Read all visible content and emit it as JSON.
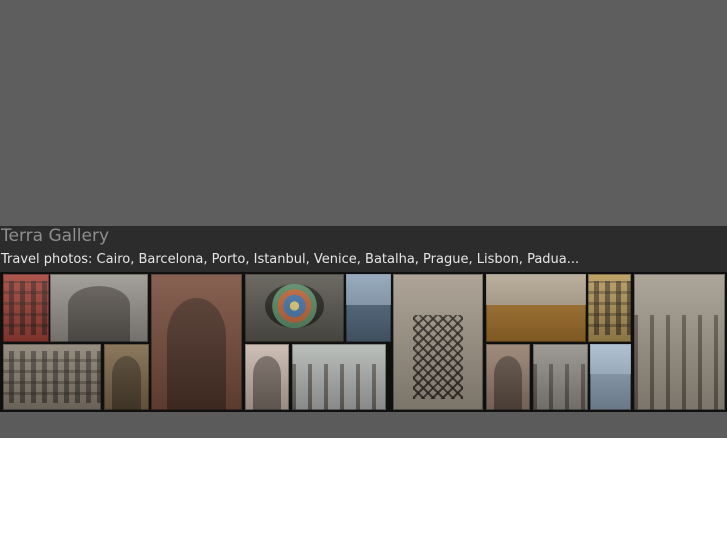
{
  "site": {
    "title": "Terra Gallery",
    "subtitle": "Travel photos: Cairo, Barcelona, Porto, Istanbul, Venice, Batalha, Prague, Lisbon, Padua..."
  },
  "colors": {
    "top_band": "#5e5e5e",
    "header_band": "#2c2c2c",
    "title_text": "#8e8e8e",
    "subtitle_text": "#e6e6e6",
    "strip_background": "#101010",
    "bottom_band": "#5b5b5b"
  },
  "gallery": {
    "thumbnails": [
      {
        "name": "photo-red-facade",
        "color": "#a5433a",
        "motif": "win"
      },
      {
        "name": "photo-ornate-pavilion",
        "color": "#9a9690",
        "motif": "arch"
      },
      {
        "name": "photo-venice-canal-bridge",
        "color": "#7a4f3e",
        "motif": "arch"
      },
      {
        "name": "photo-mosaic-medallion",
        "color": "#5c5a52",
        "motif": "rose"
      },
      {
        "name": "photo-gondolas",
        "color": "#536a80",
        "motif": "sky"
      },
      {
        "name": "photo-ornate-lattice-window",
        "color": "#a59b8c",
        "motif": "grille"
      },
      {
        "name": "photo-rooftops",
        "color": "#a8752e",
        "motif": "sky"
      },
      {
        "name": "photo-window-yellow-wall",
        "color": "#b79a5a",
        "motif": "win"
      },
      {
        "name": "photo-cloister-arches",
        "color": "#a49c8e",
        "motif": "cols"
      },
      {
        "name": "photo-porto-riverside",
        "color": "#8c8274",
        "motif": "win"
      },
      {
        "name": "photo-narrow-alley",
        "color": "#7f6a4b",
        "motif": "arch"
      },
      {
        "name": "photo-white-arched-windows",
        "color": "#c9b9ae",
        "motif": "arch"
      },
      {
        "name": "photo-courtyard-arches",
        "color": "#b3b7b4",
        "motif": "cols"
      },
      {
        "name": "photo-gothic-window",
        "color": "#96806f",
        "motif": "arch"
      },
      {
        "name": "photo-doge-palace",
        "color": "#94918a",
        "motif": "cols"
      },
      {
        "name": "photo-campanile-piazzetta",
        "color": "#8da0b4",
        "motif": "sky"
      }
    ]
  }
}
